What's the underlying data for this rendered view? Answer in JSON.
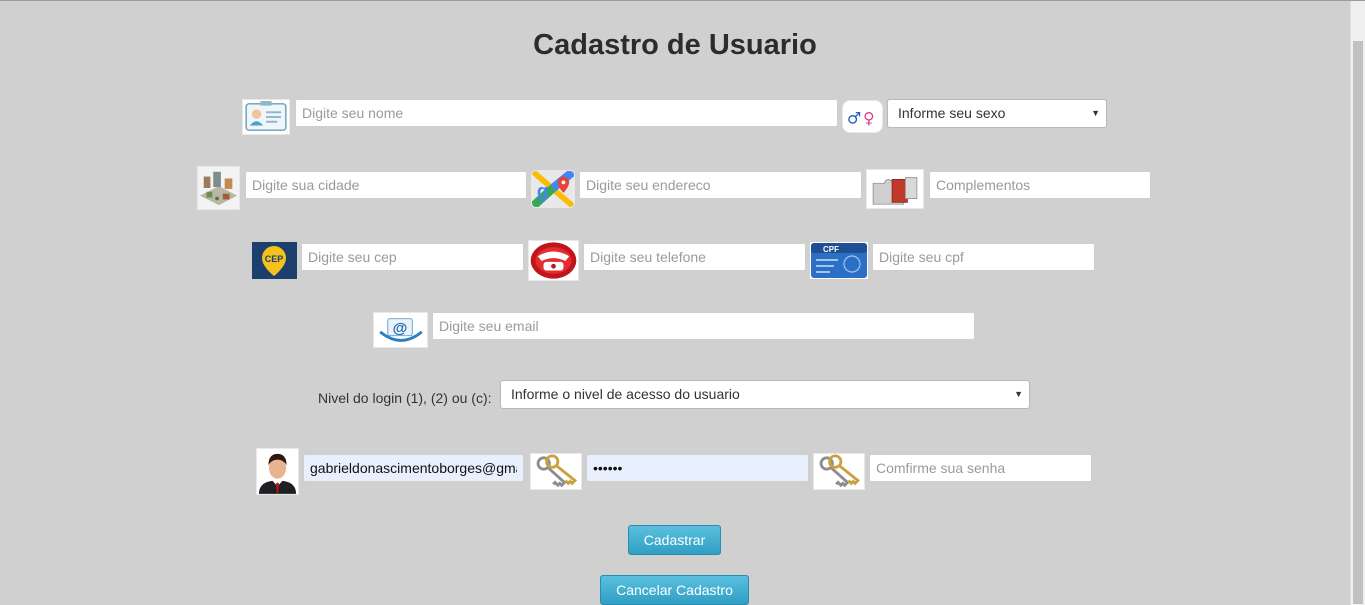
{
  "title": "Cadastro de Usuario",
  "fields": {
    "nome": {
      "placeholder": "Digite seu nome"
    },
    "sexo": {
      "selected": "Informe seu sexo"
    },
    "cidade": {
      "placeholder": "Digite sua cidade"
    },
    "endereco": {
      "placeholder": "Digite seu endereco"
    },
    "complemento": {
      "placeholder": "Complementos"
    },
    "cep": {
      "placeholder": "Digite seu cep"
    },
    "telefone": {
      "placeholder": "Digite seu telefone"
    },
    "cpf": {
      "placeholder": "Digite seu cpf"
    },
    "email": {
      "placeholder": "Digite seu email"
    },
    "nivel": {
      "label": "Nivel do login (1), (2) ou (c):",
      "selected": "Informe o nivel de acesso do usuario"
    },
    "login": {
      "value": "gabrieldonascimentoborges@gmail.com"
    },
    "senha": {
      "value": "••••••"
    },
    "confirma": {
      "placeholder": "Comfirme sua senha"
    }
  },
  "icons": {
    "id_card": "id-card-icon",
    "gender": "gender-icon",
    "city": "city-map-icon",
    "address": "google-maps-icon",
    "complement": "puzzle-icon",
    "cep": "cep-badge-icon",
    "phone": "telephone-icon",
    "cpf": "cpf-card-icon",
    "email": "email-icon",
    "user": "user-avatar-icon",
    "key": "keys-icon"
  },
  "icon_text": {
    "cep": "CEP",
    "cpf": "CPF",
    "male": "♂",
    "female": "♀",
    "at": "@"
  },
  "buttons": {
    "submit": "Cadastrar",
    "cancel": "Cancelar Cadastro"
  },
  "colors": {
    "background": "#d0d0d0",
    "button": "#31a6cc",
    "autofill": "#e8f0fe"
  }
}
